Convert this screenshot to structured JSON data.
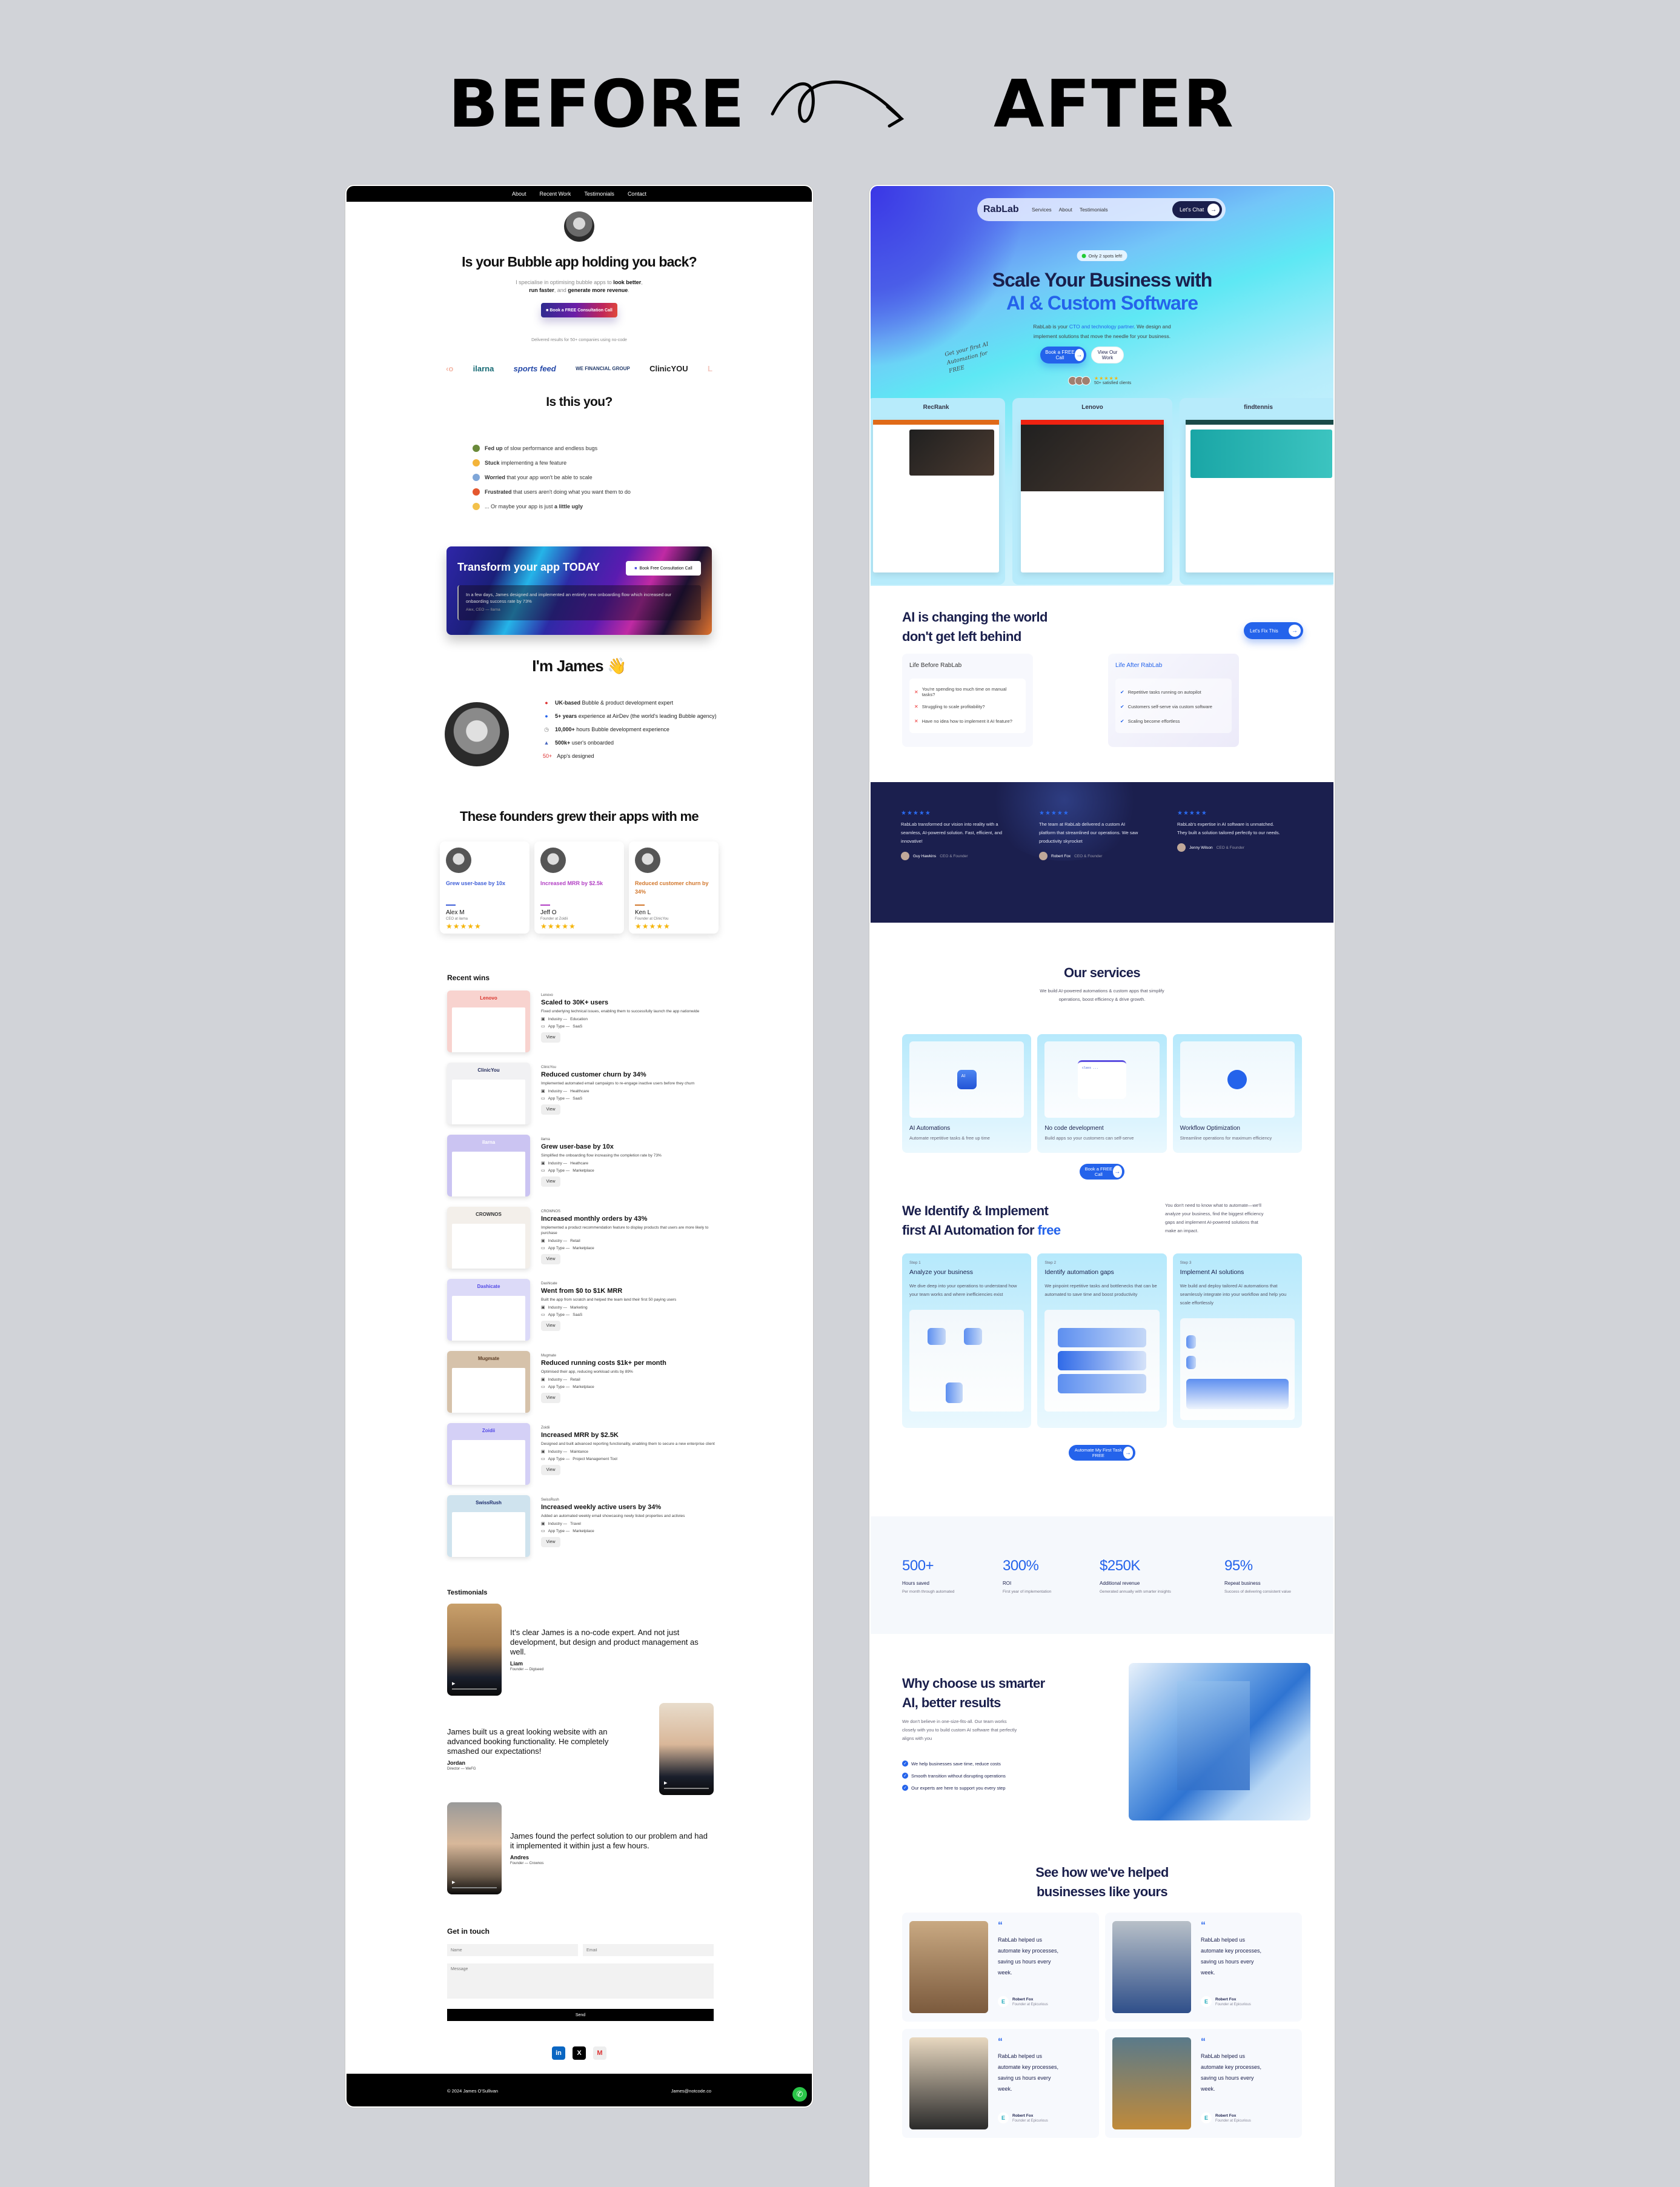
{
  "header": {
    "before": "BEFORE",
    "after": "AFTER",
    "arrow_icon": "curly-arrow-icon"
  },
  "before": {
    "nav": [
      "About",
      "Recent Work",
      "Testimonials",
      "Contact"
    ],
    "hero": {
      "title": "Is your Bubble app holding you back?",
      "subtitle_pre": "I specialise in optimising bubble apps to ",
      "subtitle_b1": "look better",
      "subtitle_mid1": ", ",
      "subtitle_b2": "run faster",
      "subtitle_mid2": ", and ",
      "subtitle_b3": "generate more revenue",
      "subtitle_end": ".",
      "cta": "Book a FREE Consultation Call",
      "delivered": "Delivered results for 50+ companies using no-code",
      "logos": [
        "ilarna",
        "sports feed",
        "WE FINANCIAL GROUP",
        "ClinicYOU"
      ]
    },
    "pains": {
      "title": "Is this you?",
      "items": [
        {
          "bold": "Fed up",
          "text": " of slow performance and endless bugs",
          "icon": "turtle-icon"
        },
        {
          "bold": "Stuck",
          "text": " implementing a few feature",
          "icon": "weary-face-icon"
        },
        {
          "bold": "Worried",
          "text": " that your app won't be able to scale",
          "icon": "fearful-face-icon"
        },
        {
          "bold": "Frustrated",
          "text": " that users aren't doing what you want them to do",
          "icon": "angry-face-icon"
        },
        {
          "bold": "a little ugly",
          "text": "... Or maybe your app is just ",
          "icon": "shushing-face-icon"
        }
      ]
    },
    "transform": {
      "title": "Transform your app TODAY",
      "button": "Book Free Consultation Call",
      "quote": "In a few days, James designed and implemented an entirely new onboarding flow which increased our onbaording success rate by 73%",
      "author": "Alex, CEO — Ilarna"
    },
    "about": {
      "title": "I'm James",
      "title_emoji": "👋",
      "facts": [
        {
          "bold": "UK-based",
          "text": " Bubble & product development expert",
          "icon": "pin-icon"
        },
        {
          "bold": "5+ years",
          "text": " experience at AirDev (the world's leading Bubble agency)",
          "icon": "airdev-icon"
        },
        {
          "bold": "10,000+",
          "text": " hours Bubble development experience",
          "icon": "stopwatch-icon"
        },
        {
          "bold": "500k+",
          "text": " user's onboarded",
          "icon": "users-icon"
        },
        {
          "bold": "50+",
          "text": " App's designed",
          "icon": "fifty-icon"
        }
      ]
    },
    "founders": {
      "title": "These founders grew their apps with me",
      "cards": [
        {
          "result": "Grew user-base by 10x",
          "name": "Alex M",
          "role": "CEO at ilarna",
          "stars": 5,
          "color": "#3f5fd8"
        },
        {
          "result": "Increased MRR by $2.5k",
          "name": "Jeff O",
          "role": "Founder at Zoidii",
          "stars": 5,
          "color": "#b23fc4"
        },
        {
          "result": "Reduced customer churn by 34%",
          "name": "Ken L",
          "role": "Founder at ClinicYou",
          "stars": 5,
          "color": "#d2772c"
        }
      ]
    },
    "wins": {
      "title": "Recent wins",
      "industry_label": "Industry —",
      "apptype_label": "App Type —",
      "view_label": "View",
      "items": [
        {
          "company": "Lenovo",
          "title": "Scaled to 30K+ users",
          "desc": "Fixed underlying technical issues, enabling them to successfully launch the app nationwide",
          "industry": "Education",
          "app_type": "SaaS",
          "bg": "#f8d3cf",
          "logo_color": "#d8322a"
        },
        {
          "company": "ClinicYou",
          "title": "Reduced customer churn by 34%",
          "desc": "Implemented automated email campaigns to re-engage inactive users before they churn",
          "industry": "Healthcare",
          "app_type": "SaaS",
          "bg": "#f1f1f3",
          "logo_color": "#222a5a"
        },
        {
          "company": "ilarna",
          "title": "Grew user-base by 10x",
          "desc": "Simplified the onboarding flow increasing the completion rate by 73%",
          "industry": "Heathcare",
          "app_type": "Marketplace",
          "bg": "#cbc4f2",
          "logo_color": "#ffffff"
        },
        {
          "company": "CROWNOS",
          "title": "Increased monthly orders by 43%",
          "desc": "Implemented a product recommendation feature to display products that users are more likely to purchase",
          "industry": "Retail",
          "app_type": "Marketplace",
          "bg": "#f3efea",
          "logo_color": "#333333"
        },
        {
          "company": "Dashicate",
          "title": "Went from $0 to $1K MRR",
          "desc": "Built the app from scratch and helped the team land their first 50 paying users",
          "industry": "Marketing",
          "app_type": "SaaS",
          "bg": "#dcdaf8",
          "logo_color": "#4f46e5"
        },
        {
          "company": "Mugmate",
          "title": "Reduced running costs $1k+ per month",
          "desc": "Optimised their app, reducing workload units by 89%",
          "industry": "Retail",
          "app_type": "Marketplace",
          "bg": "#d6c2aa",
          "logo_color": "#5a3a22"
        },
        {
          "company": "Zoidii",
          "title": "Increased MRR by $2.5K",
          "desc": "Designed and built advanced reporting functionality, enabling them to secure a new enterprise client",
          "industry": "Maintance",
          "app_type": "Project Management Tool",
          "bg": "#d4d0f6",
          "logo_color": "#4f46e5"
        },
        {
          "company": "SwissRush",
          "title": "Increased weekly active users by 34%",
          "desc": "Added an automated weekly email showcasing newly listed properties and activies",
          "industry": "Travel",
          "app_type": "Marketplace",
          "bg": "#cfe3ee",
          "logo_color": "#1a2a6a"
        }
      ]
    },
    "testimonials": {
      "title": "Testimonials",
      "items": [
        {
          "quote": "It's clear James is a no-code expert. And not just development, but design and product management as well.",
          "name": "Liam",
          "role": "Founder — Digiseed"
        },
        {
          "quote": "James built us a great looking website with an advanced booking functionality. He completely smashed our expectations!",
          "name": "Jordan",
          "role": "Director — WeFG"
        },
        {
          "quote": "James found the perfect solution to our problem and had it implemented it within just a few hours.",
          "name": "Andres",
          "role": "Founder — Crownos"
        }
      ]
    },
    "contact": {
      "title": "Get in touch",
      "name_placeholder": "Name",
      "email_placeholder": "Email",
      "message_placeholder": "Message",
      "send": "Send",
      "socials": [
        "linkedin-icon",
        "x-icon",
        "gmail-icon"
      ]
    },
    "footer": {
      "copyright": "© 2024 James O'Sullivan",
      "email": "James@notcode.co"
    }
  },
  "after": {
    "nav": {
      "logo": "RabLab",
      "links": [
        "Services",
        "About",
        "Testimonials"
      ],
      "cta": "Let's Chat"
    },
    "hero": {
      "badge": "Only 2 spots left!",
      "title_line1": "Scale Your Business with",
      "title_line2": "AI & Custom Software",
      "sub_pre": "RabLab is your ",
      "sub_link": "CTO and technology partner",
      "sub_post": ". We design and implement solutions that move the needle for your business.",
      "handwritten": "Get your first AI Automation for FREE",
      "cta_primary": "Book a FREE Call",
      "cta_secondary": "View Our Work",
      "rating_stars": 5,
      "social_proof": "50+ satisfied clients",
      "showcase": [
        "RecRank",
        "Lenovo",
        "findtennis"
      ]
    },
    "ai": {
      "title_line1": "AI is changing the world",
      "title_line2": "don't get left behind",
      "cta": "Let's Fix This",
      "before_title": "Life Before RabLab",
      "before_items": [
        "You're spending too much time on manual tasks?",
        "Struggling to scale profitability?",
        "Have no idea how to implement it AI feature?"
      ],
      "after_title": "Life After RabLab",
      "after_items": [
        "Repetitive tasks running on autopilot",
        "Customers self-serve via custom software",
        "Scaling become effortless"
      ]
    },
    "reviews": [
      {
        "stars": 5,
        "text": "RabLab transformed our vision into reality with a seamless, AI-powered solution. Fast, efficient, and innovative!",
        "name": "Guy Hawkins",
        "role": "CEO & Founder"
      },
      {
        "stars": 5,
        "text": "The team at RabLab delivered a custom AI platform that streamlined our operations. We saw productivity skyrocket",
        "name": "Robert Fox",
        "role": "CEO & Founder"
      },
      {
        "stars": 5,
        "text": "RabLab's expertise in AI software is unmatched. They built a solution tailored perfectly to our needs.",
        "name": "Jenny Wilson",
        "role": "CEO & Founder"
      }
    ],
    "services": {
      "title": "Our services",
      "desc": "We build AI-powered automations & custom apps that simplify operations, boost efficiency & drive growth.",
      "cards": [
        {
          "title": "AI Automations",
          "desc": "Automate repetitive tasks & free up time"
        },
        {
          "title": "No code development",
          "desc": "Build apps so your customers can self-serve"
        },
        {
          "title": "Workflow Optimization",
          "desc": "Streamline operations for maximum efficiency"
        }
      ],
      "cta": "Book a FREE Call"
    },
    "identify": {
      "title_line1": "We Identify & Implement",
      "title_line2_pre": "first AI Automation for ",
      "title_line2_accent": "free",
      "desc": "You don't need to know what to automate—we'll analyze your business, find the biggest efficiency gaps and implement AI-powered solutions that make an impact.",
      "steps": [
        {
          "step": "Step 1",
          "title": "Analyze your business",
          "desc": "We dive deep into your operations to understand how your team works and where inefficiencies exist"
        },
        {
          "step": "Step 2",
          "title": "Identify automation gaps",
          "desc": "We pinpoint repetitive tasks and bottlenecks that can be automated to save time and boost productivity"
        },
        {
          "step": "Step 3",
          "title": "Implement AI solutions",
          "desc": "We build and deploy tailored AI automations that seamlessly integrate into your workflow and help you scale effortlessly"
        }
      ],
      "cta": "Automate My First Task FREE"
    },
    "stats": [
      {
        "value": "500+",
        "label": "Hours saved",
        "desc": "Per month through automated"
      },
      {
        "value": "300%",
        "label": "ROI",
        "desc": "First year of implementation"
      },
      {
        "value": "$250K",
        "label": "Additional revenue",
        "desc": "Generated annually with smarter insights"
      },
      {
        "value": "95%",
        "label": "Repeat business",
        "desc": "Success of delivering consistent value"
      }
    ],
    "why": {
      "title_line1": "Why choose us smarter",
      "title_line2": "AI, better results",
      "desc": "We don't believe in one-size-fits-all. Our team works closely with you to build custom AI software that perfectly aligns with you",
      "points": [
        "We help businesses save time, reduce costs",
        "Smooth transition without disrupting operations",
        "Our experts are here to support you every step"
      ]
    },
    "help": {
      "title_line1": "See how we've helped",
      "title_line2": "businesses like yours",
      "cards": [
        {
          "quote": "RabLab helped us automate key processes, saving us hours every week.",
          "name": "Robert Fox",
          "role": "Founder at Epicurious"
        },
        {
          "quote": "RabLab helped us automate key processes, saving us hours every week.",
          "name": "Robert Fox",
          "role": "Founder at Epicurious"
        },
        {
          "quote": "RabLab helped us automate key processes, saving us hours every week.",
          "name": "Robert Fox",
          "role": "Founder at Epicurious"
        },
        {
          "quote": "RabLab helped us automate key processes, saving us hours every week.",
          "name": "Robert Fox",
          "role": "Founder at Epicurious"
        }
      ]
    }
  }
}
